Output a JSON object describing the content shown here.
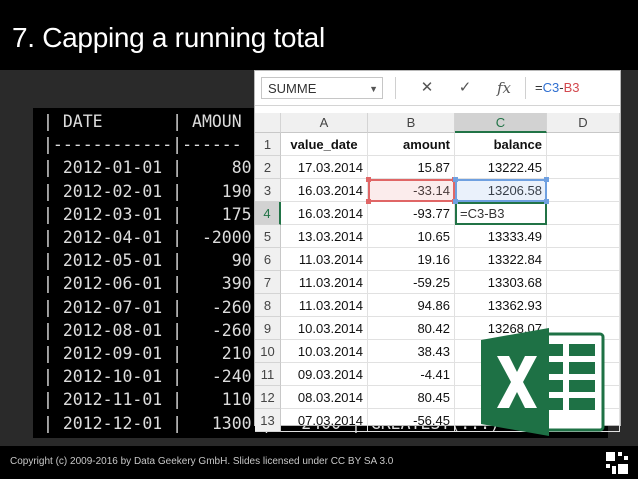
{
  "slide": {
    "title": "7. Capping a running total",
    "footer": "Copyright (c) 2009-2016 by Data Geekery GmbH. Slides licensed under CC BY SA 3.0"
  },
  "terminal": {
    "lines": [
      "| DATE       | AMOUN",
      "|------------|------",
      "| 2012-01-01 |     80",
      "| 2012-02-01 |    190",
      "| 2012-03-01 |    175",
      "| 2012-04-01 |  -2000",
      "| 2012-05-01 |     90",
      "| 2012-06-01 |    390",
      "| 2012-07-01 |   -260",
      "| 2012-08-01 |   -260",
      "| 2012-09-01 |    210",
      "| 2012-10-01 |   -240",
      "| 2012-11-01 |    110",
      "| 2012-12-01 |   1300 |   2400 | GREATEST(...)"
    ]
  },
  "excel": {
    "namebox": "SUMME",
    "cancel_icon": "✕",
    "enter_icon": "✓",
    "fx_icon": "fx",
    "formula_prefix": "=",
    "formula_ref1": "C3",
    "formula_op": "-",
    "formula_ref2": "B3",
    "columns": [
      "A",
      "B",
      "C",
      "D"
    ],
    "header_row": [
      "value_date",
      "amount",
      "balance"
    ],
    "rows": [
      {
        "n": "3",
        "a": "16.03.2014",
        "b": "-33.14",
        "c": "13206.58"
      },
      {
        "n": "4",
        "a": "16.03.2014",
        "b": "-93.77",
        "c": "=C3-B3"
      },
      {
        "n": "5",
        "a": "13.03.2014",
        "b": "10.65",
        "c": "13333.49"
      },
      {
        "n": "6",
        "a": "11.03.2014",
        "b": "19.16",
        "c": "13322.84"
      },
      {
        "n": "7",
        "a": "11.03.2014",
        "b": "-59.25",
        "c": "13303.68"
      },
      {
        "n": "8",
        "a": "11.03.2014",
        "b": "94.86",
        "c": "13362.93"
      },
      {
        "n": "9",
        "a": "10.03.2014",
        "b": "80.42",
        "c": "13268.07"
      },
      {
        "n": "10",
        "a": "10.03.2014",
        "b": "38.43",
        "c": ""
      },
      {
        "n": "11",
        "a": "09.03.2014",
        "b": "-4.41",
        "c": ""
      },
      {
        "n": "12",
        "a": "08.03.2014",
        "b": "80.45",
        "c": ""
      },
      {
        "n": "13",
        "a": "07.03.2014",
        "b": "-56.45",
        "c": ""
      }
    ],
    "row2": {
      "n": "2",
      "a": "17.03.2014",
      "b": "15.87",
      "c": "13222.45"
    },
    "row1_n": "1"
  },
  "colors": {
    "excel_green": "#217346",
    "ref_blue": "#2f6fd1",
    "ref_red": "#d3484e"
  }
}
